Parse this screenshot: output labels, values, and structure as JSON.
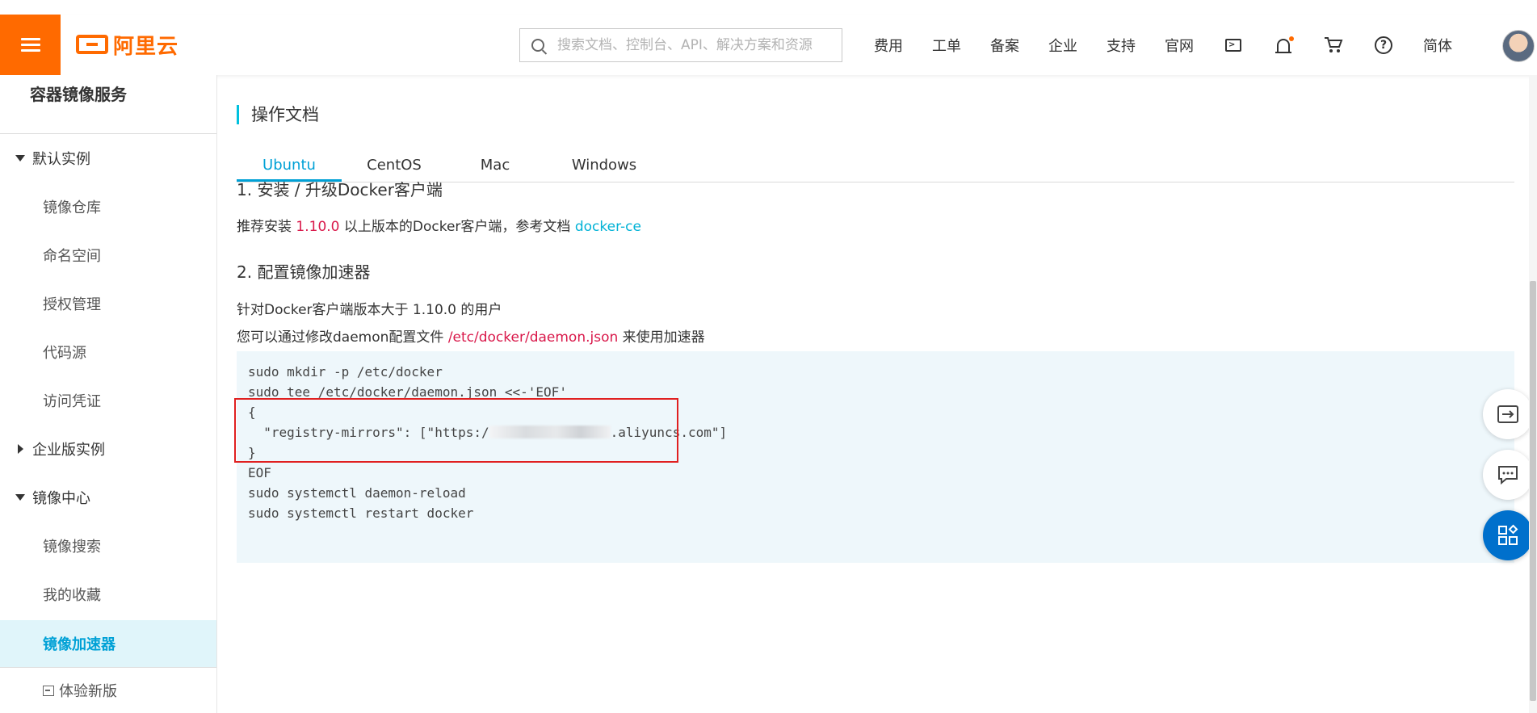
{
  "header": {
    "logo_text": "阿里云",
    "search_placeholder": "搜索文档、控制台、API、解决方案和资源",
    "nav": {
      "fees": "费用",
      "tickets": "工单",
      "icp": "备案",
      "enterprise": "企业",
      "support": "支持",
      "official": "官网",
      "lang": "简体"
    },
    "icons": [
      "menu-icon",
      "search-icon",
      "terminal-icon",
      "bell-icon",
      "cart-icon",
      "help-icon",
      "avatar"
    ],
    "brand_color": "#ff6a00"
  },
  "sidebar": {
    "title": "容器镜像服务",
    "groups": {
      "default": "默认实例",
      "enterprise": "企业版实例",
      "center": "镜像中心"
    },
    "items": {
      "repo": "镜像仓库",
      "namespace": "命名空间",
      "auth": "授权管理",
      "source": "代码源",
      "credential": "访问凭证",
      "search": "镜像搜索",
      "favorites": "我的收藏",
      "accelerator": "镜像加速器"
    },
    "new_version": "体验新版",
    "active_color": "#00a1d6"
  },
  "main": {
    "section_title": "操作文档",
    "tabs": [
      "Ubuntu",
      "CentOS",
      "Mac",
      "Windows"
    ],
    "active_tab": "Ubuntu",
    "step1": {
      "title": "1. 安装 / 升级Docker客户端",
      "text_before": "推荐安装",
      "version": "1.10.0",
      "text_after": "以上版本的Docker客户端，参考文档",
      "link": "docker-ce"
    },
    "step2": {
      "title": "2. 配置镜像加速器",
      "line1": "针对Docker客户端版本大于 1.10.0 的用户",
      "line2_before": "您可以通过修改daemon配置文件",
      "path": "/etc/docker/daemon.json",
      "line2_after": "来使用加速器"
    },
    "code": {
      "l1": "sudo mkdir -p /etc/docker",
      "l2": "sudo tee /etc/docker/daemon.json <<-'EOF'",
      "l3": "{",
      "l4_before": "  \"registry-mirrors\": [\"https:/",
      "l4_after": ".aliyuncs.com\"]",
      "l5": "}",
      "l6": "EOF",
      "l7": "sudo systemctl daemon-reload",
      "l8": "sudo systemctl restart docker"
    },
    "highlight_color": "#e02020"
  }
}
